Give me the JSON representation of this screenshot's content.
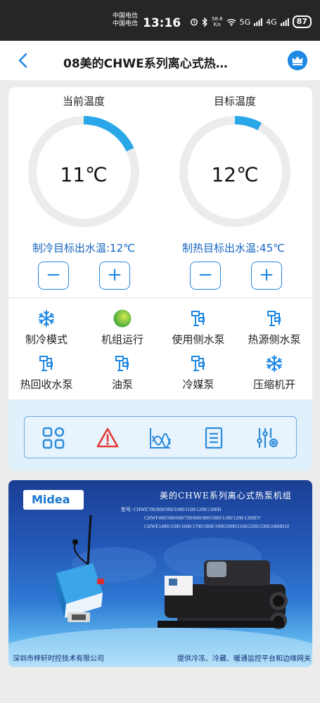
{
  "status_bar": {
    "carrier_1": "中国电信",
    "carrier_2": "中国电信",
    "time": "13:16",
    "speed_value": "58.6",
    "speed_unit": "K/s",
    "net_1": "5G",
    "net_2": "4G",
    "battery": "87"
  },
  "header": {
    "title": "08美的CHWE系列离心式热…"
  },
  "gauges": {
    "current": {
      "title": "当前温度",
      "value": "11℃",
      "level": 0.18
    },
    "target": {
      "title": "目标温度",
      "value": "12℃",
      "level": 0.08
    }
  },
  "setpoints": {
    "cooling": "制冷目标出水温:12℃",
    "heating": "制热目标出水温:45℃",
    "minus": "−",
    "plus": "+"
  },
  "status_items": [
    {
      "label": "制冷模式",
      "icon": "snowflake-icon"
    },
    {
      "label": "机组运行",
      "icon": "running-indicator-icon"
    },
    {
      "label": "使用侧水泵",
      "icon": "pump-icon"
    },
    {
      "label": "热源侧水泵",
      "icon": "pump-icon"
    },
    {
      "label": "热回收水泵",
      "icon": "pump-icon"
    },
    {
      "label": "油泵",
      "icon": "pump-icon"
    },
    {
      "label": "冷媒泵",
      "icon": "pump-icon"
    },
    {
      "label": "压缩机开",
      "icon": "snowflake-icon"
    }
  ],
  "toolbar": {
    "icons": [
      "grid-menu-icon",
      "alarm-warning-icon",
      "trend-chart-icon",
      "list-document-icon",
      "settings-sliders-icon"
    ]
  },
  "banner": {
    "logo": "Midea",
    "title": "美的CHWE系列离心式热泵机组",
    "models": [
      "型号: CHWE700/800/900/1000/1100/1200/1300H",
      "CHWF400/500/600/700/800/900/1000/1100/1200/1300EV",
      "CHWE1400/1500/1600/1700/1800/1900/2000/2100/2200/2300/2400H10"
    ],
    "footer_left": "深圳市梓轩时控技术有限公司",
    "footer_right": "提供冷冻、冷藏、暖通监控平台和边缘网关"
  },
  "colors": {
    "accent": "#1e88e5",
    "arc": "#2aa7e8",
    "running_green": "#4caf50",
    "warning_red": "#e53935"
  }
}
